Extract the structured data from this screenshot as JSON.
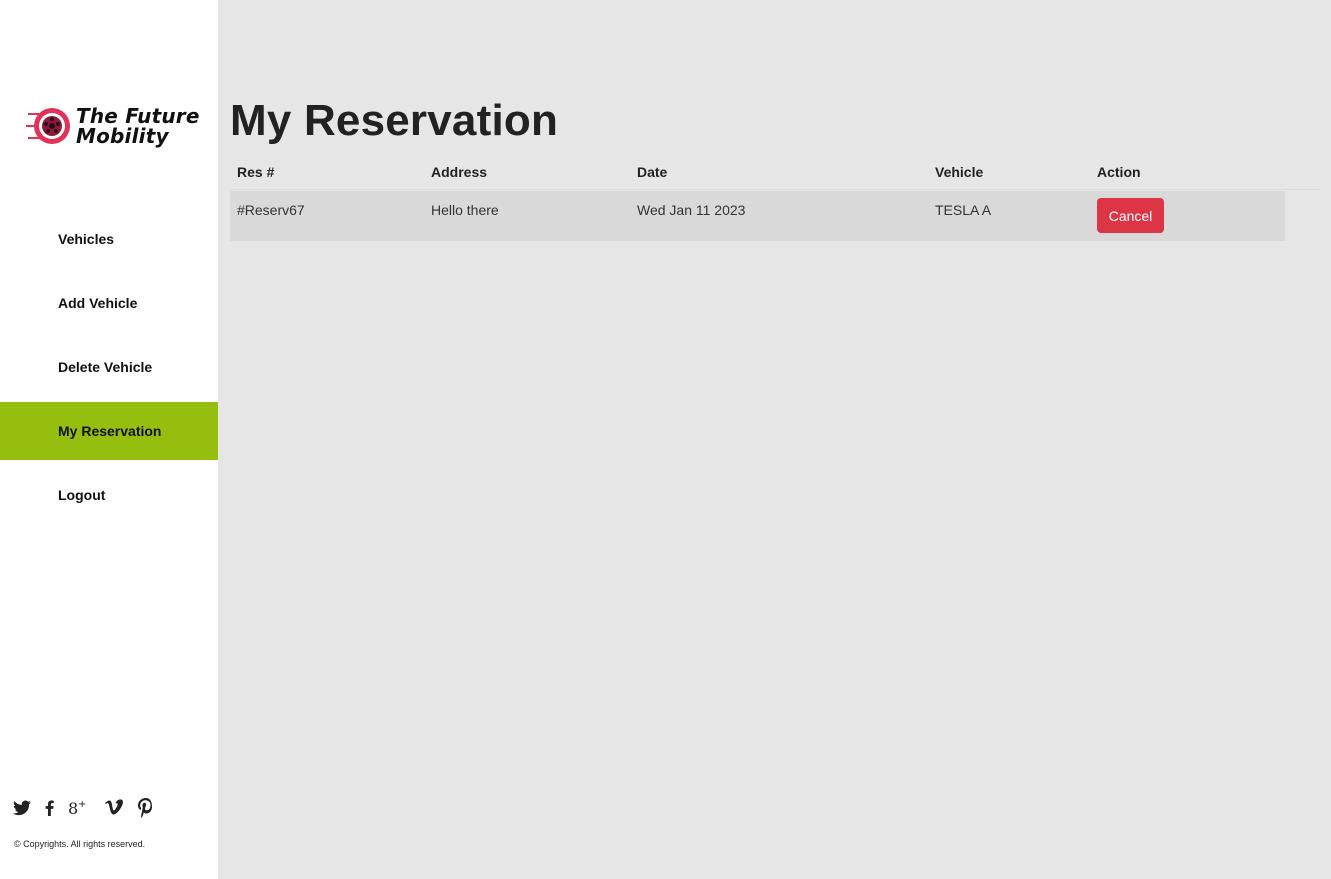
{
  "brand": {
    "line1": "The Future",
    "line2": "Mobility",
    "accent_color": "#e0325a"
  },
  "sidebar": {
    "items": [
      {
        "label": "Vehicles",
        "active": false
      },
      {
        "label": "Add Vehicle",
        "active": false
      },
      {
        "label": "Delete Vehicle",
        "active": false
      },
      {
        "label": "My Reservation",
        "active": true
      },
      {
        "label": "Logout",
        "active": false
      }
    ],
    "active_color": "#96be0e"
  },
  "social": [
    "twitter-icon",
    "facebook-icon",
    "google-plus-icon",
    "vimeo-icon",
    "pinterest-icon"
  ],
  "footer": {
    "copyright": "© Copyrights. All rights reserved."
  },
  "main": {
    "title": "My Reservation",
    "table": {
      "columns": [
        "Res #",
        "Address",
        "Date",
        "Vehicle",
        "Action"
      ],
      "rows": [
        {
          "res": "#Reserv67",
          "address": "Hello there",
          "date": "Wed Jan 11 2023",
          "vehicle": "TESLA A",
          "action": "Cancel"
        }
      ]
    },
    "cancel_color": "#dc3545"
  }
}
